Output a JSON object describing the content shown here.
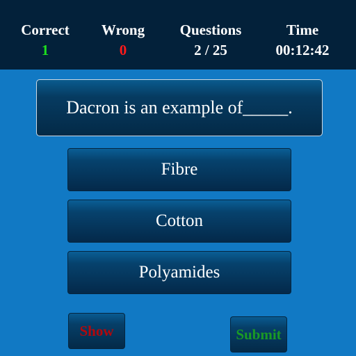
{
  "stats": {
    "correct": {
      "label": "Correct",
      "value": "1",
      "color": "#1ee01e"
    },
    "wrong": {
      "label": "Wrong",
      "value": "0",
      "color": "#ff1a1a"
    },
    "questions": {
      "label": "Questions",
      "value": "2 / 25"
    },
    "time": {
      "label": "Time",
      "value": "00:12:42"
    }
  },
  "question": {
    "text": "Dacron is an example of_____."
  },
  "options": [
    {
      "label": "Fibre"
    },
    {
      "label": "Cotton"
    },
    {
      "label": "Polyamides"
    }
  ],
  "actions": {
    "show_label": "Show",
    "submit_label": "Submit"
  }
}
